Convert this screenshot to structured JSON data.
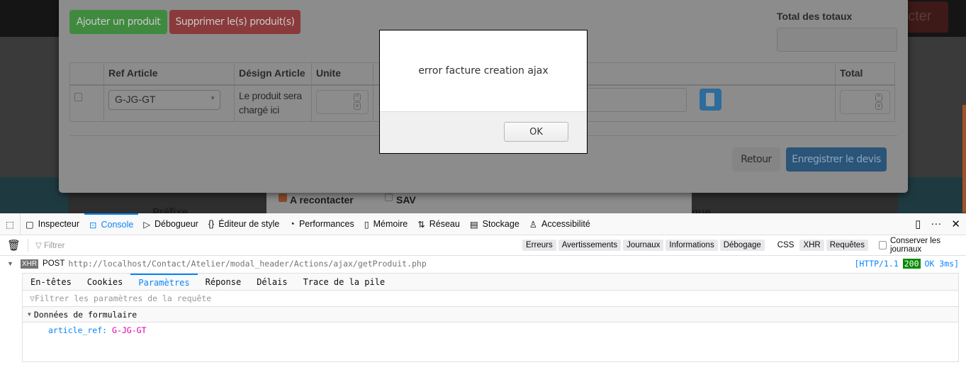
{
  "background": {
    "labels": {
      "recontact": "A recontacter",
      "sav": "SAV",
      "prefix": "Préfixe",
      "partial": "que",
      "header_button": "ecter"
    }
  },
  "modal": {
    "add_button": "Ajouter un produit",
    "delete_button": "Supprimer le(s) produit(s)",
    "total_label": "Total des totaux",
    "total_value": "",
    "table": {
      "headers": [
        "",
        "Ref Article",
        "Désign Article",
        "Unite",
        "",
        "Total"
      ],
      "rows": [
        {
          "ref": "G-JG-GT",
          "design": "Le produit sera chargé ici",
          "unite": "",
          "total": ""
        }
      ]
    },
    "back_button": "Retour",
    "save_button": "Enregistrer le devis"
  },
  "alert": {
    "message": "error facture creation ajax",
    "ok": "OK"
  },
  "devtools": {
    "tools": [
      "Inspecteur",
      "Console",
      "Débogueur",
      "Éditeur de style",
      "Performances",
      "Mémoire",
      "Réseau",
      "Stockage",
      "Accessibilité"
    ],
    "active_tool": "Console",
    "filter_placeholder": "Filtrer",
    "levels": [
      "Erreurs",
      "Avertissements",
      "Journaux",
      "Informations",
      "Débogage"
    ],
    "extra_filters": [
      "CSS",
      "XHR",
      "Requêtes"
    ],
    "persist_label": "Conserver les journaux",
    "request": {
      "type": "XHR",
      "method": "POST",
      "url": "http://localhost/Contact/Atelier/modal_header/Actions/ajax/getProduit.php",
      "protocol": "[HTTP/1.1",
      "status": "200",
      "status_text": "OK 3ms]"
    },
    "panel_tabs": [
      "En-têtes",
      "Cookies",
      "Paramètres",
      "Réponse",
      "Délais",
      "Trace de la pile"
    ],
    "active_panel_tab": "Paramètres",
    "params_filter_placeholder": "Filtrer les paramètres de la requête",
    "section_title": "Données de formulaire",
    "params": [
      {
        "key": "article_ref:",
        "value": "G-JG-GT"
      }
    ]
  },
  "colors": {
    "accent": "#0a84ff",
    "status_ok": "#058b00",
    "param_value": "#dd00a9"
  }
}
